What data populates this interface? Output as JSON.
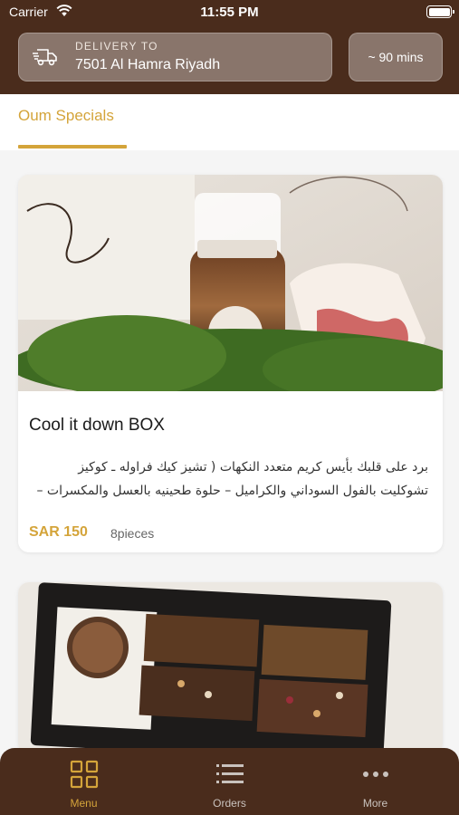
{
  "status_bar": {
    "carrier": "Carrier",
    "time": "11:55 PM"
  },
  "delivery": {
    "label": "DELIVERY TO",
    "address": "7501 Al Hamra Riyadh",
    "eta": "~ 90 mins"
  },
  "category_tab": {
    "active_label": "Oum Specials"
  },
  "products": [
    {
      "title": "Cool it down BOX",
      "description": "برد على قلبك بأيس كريم متعدد النكهات ( تشيز كيك فراوله ـ كوكيز تشوكليت بالفول السوداني والكراميل – حلوة طحينيه بالعسل والمكسرات – الخوخ م....",
      "price": "SAR 150",
      "pieces": "8pieces"
    }
  ],
  "tabbar": {
    "items": [
      {
        "label": "Menu",
        "icon": "grid-icon"
      },
      {
        "label": "Orders",
        "icon": "list-icon"
      },
      {
        "label": "More",
        "icon": "more-icon"
      }
    ]
  },
  "colors": {
    "brand_brown": "#4a2c1c",
    "accent_gold": "#d4a43a"
  }
}
